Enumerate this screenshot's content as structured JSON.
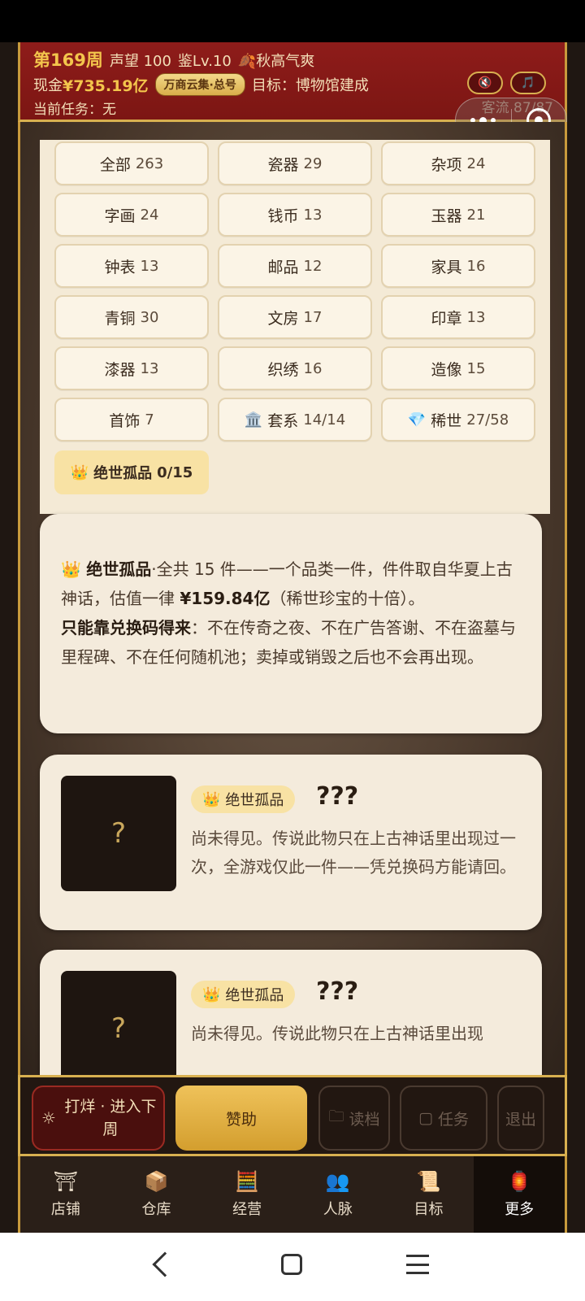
{
  "header": {
    "week": "第169周",
    "reputation": "声望 100",
    "appraisal": "鉴Lv.10",
    "season_icon": "maple-leaf-icon",
    "season": "秋高气爽",
    "cash_label": "现金",
    "cash": "¥735.19亿",
    "badge": "万商云集·总号",
    "goal": "目标：博物馆建成",
    "task": "当前任务：无",
    "visitors": "客流 87/87",
    "mute_icon": "🔇",
    "music_icon": "🎵"
  },
  "filters": [
    {
      "label": "全部",
      "count": "263"
    },
    {
      "label": "瓷器",
      "count": "29"
    },
    {
      "label": "杂项",
      "count": "24"
    },
    {
      "label": "字画",
      "count": "24"
    },
    {
      "label": "钱币",
      "count": "13"
    },
    {
      "label": "玉器",
      "count": "21"
    },
    {
      "label": "钟表",
      "count": "13"
    },
    {
      "label": "邮品",
      "count": "12"
    },
    {
      "label": "家具",
      "count": "16"
    },
    {
      "label": "青铜",
      "count": "30"
    },
    {
      "label": "文房",
      "count": "17"
    },
    {
      "label": "印章",
      "count": "13"
    },
    {
      "label": "漆器",
      "count": "13"
    },
    {
      "label": "织绣",
      "count": "16"
    },
    {
      "label": "造像",
      "count": "15"
    },
    {
      "label": "首饰",
      "count": "7"
    },
    {
      "label": "套系",
      "count": "14/14",
      "icon": "🏛️"
    },
    {
      "label": "稀世",
      "count": "27/58",
      "icon": "💎"
    }
  ],
  "legend_filter": {
    "icon": "👑",
    "label": "绝世孤品",
    "count": "0/15"
  },
  "info": {
    "icon": "👑",
    "title": "绝世孤品",
    "text1": "·全共 15 件——一个品类一件，件件取自华夏上古神话，估值一律 ",
    "price": "¥159.84亿",
    "text2": "（稀世珍宝的十倍）。",
    "bold2": "只能靠兑换码得来",
    "text3": "：不在传奇之夜、不在广告答谢、不在盗墓与里程碑、不在任何随机池；卖掉或销毁之后也不会再出现。"
  },
  "items": [
    {
      "thumb": "?",
      "tag_icon": "👑",
      "tag": "绝世孤品",
      "name": "???",
      "desc": "尚未得见。传说此物只在上古神话里出现过一次，全游戏仅此一件——凭兑换码方能请回。"
    },
    {
      "thumb": "?",
      "tag_icon": "👑",
      "tag": "绝世孤品",
      "name": "???",
      "desc": "尚未得见。传说此物只在上古神话里出现"
    }
  ],
  "actions": {
    "next_icon": "☼",
    "next": "打烊 · 进入下周",
    "sponsor": "赞助",
    "load": "读档",
    "task": "任务",
    "exit": "退出"
  },
  "tabs": [
    {
      "icon": "⛩",
      "label": "店铺"
    },
    {
      "icon": "📦",
      "label": "仓库"
    },
    {
      "icon": "🧮",
      "label": "经营"
    },
    {
      "icon": "👥",
      "label": "人脉"
    },
    {
      "icon": "📜",
      "label": "目标"
    },
    {
      "icon": "🏮",
      "label": "更多"
    }
  ]
}
